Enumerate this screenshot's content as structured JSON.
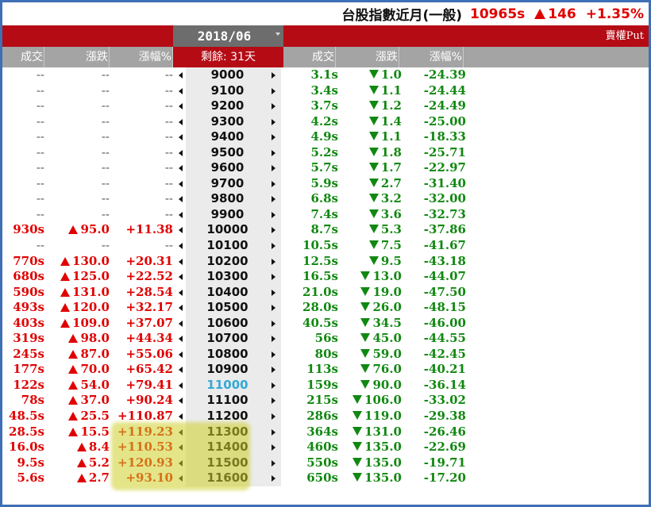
{
  "header": {
    "instrument": "台股指數近月(一般)",
    "price": "10965s",
    "change": "146",
    "change_pct": "+1.35%"
  },
  "month_selector": {
    "value": "2018/06"
  },
  "put_label": "賣權Put",
  "remaining": "剩餘: 31天",
  "columns": {
    "call": [
      "成交",
      "漲跌",
      "漲幅%"
    ],
    "put": [
      "成交",
      "漲跌",
      "漲幅%"
    ]
  },
  "colors": {
    "up": "#e00000",
    "down": "#118811",
    "header_red": "#b50b14",
    "atm_strike": "#33a8d6",
    "highlight": "#cdcd28"
  },
  "rows": [
    {
      "c_vol": "--",
      "c_dir": "",
      "c_chg": "--",
      "c_pct": "--",
      "strike": "9000",
      "p_vol": "3.1s",
      "p_dir": "down",
      "p_chg": "1.0",
      "p_pct": "-24.39"
    },
    {
      "c_vol": "--",
      "c_dir": "",
      "c_chg": "--",
      "c_pct": "--",
      "strike": "9100",
      "p_vol": "3.4s",
      "p_dir": "down",
      "p_chg": "1.1",
      "p_pct": "-24.44"
    },
    {
      "c_vol": "--",
      "c_dir": "",
      "c_chg": "--",
      "c_pct": "--",
      "strike": "9200",
      "p_vol": "3.7s",
      "p_dir": "down",
      "p_chg": "1.2",
      "p_pct": "-24.49"
    },
    {
      "c_vol": "--",
      "c_dir": "",
      "c_chg": "--",
      "c_pct": "--",
      "strike": "9300",
      "p_vol": "4.2s",
      "p_dir": "down",
      "p_chg": "1.4",
      "p_pct": "-25.00"
    },
    {
      "c_vol": "--",
      "c_dir": "",
      "c_chg": "--",
      "c_pct": "--",
      "strike": "9400",
      "p_vol": "4.9s",
      "p_dir": "down",
      "p_chg": "1.1",
      "p_pct": "-18.33"
    },
    {
      "c_vol": "--",
      "c_dir": "",
      "c_chg": "--",
      "c_pct": "--",
      "strike": "9500",
      "p_vol": "5.2s",
      "p_dir": "down",
      "p_chg": "1.8",
      "p_pct": "-25.71"
    },
    {
      "c_vol": "--",
      "c_dir": "",
      "c_chg": "--",
      "c_pct": "--",
      "strike": "9600",
      "p_vol": "5.7s",
      "p_dir": "down",
      "p_chg": "1.7",
      "p_pct": "-22.97"
    },
    {
      "c_vol": "--",
      "c_dir": "",
      "c_chg": "--",
      "c_pct": "--",
      "strike": "9700",
      "p_vol": "5.9s",
      "p_dir": "down",
      "p_chg": "2.7",
      "p_pct": "-31.40"
    },
    {
      "c_vol": "--",
      "c_dir": "",
      "c_chg": "--",
      "c_pct": "--",
      "strike": "9800",
      "p_vol": "6.8s",
      "p_dir": "down",
      "p_chg": "3.2",
      "p_pct": "-32.00"
    },
    {
      "c_vol": "--",
      "c_dir": "",
      "c_chg": "--",
      "c_pct": "--",
      "strike": "9900",
      "p_vol": "7.4s",
      "p_dir": "down",
      "p_chg": "3.6",
      "p_pct": "-32.73"
    },
    {
      "c_vol": "930s",
      "c_dir": "up",
      "c_chg": "95.0",
      "c_pct": "+11.38",
      "strike": "10000",
      "p_vol": "8.7s",
      "p_dir": "down",
      "p_chg": "5.3",
      "p_pct": "-37.86"
    },
    {
      "c_vol": "--",
      "c_dir": "",
      "c_chg": "--",
      "c_pct": "--",
      "strike": "10100",
      "p_vol": "10.5s",
      "p_dir": "down",
      "p_chg": "7.5",
      "p_pct": "-41.67"
    },
    {
      "c_vol": "770s",
      "c_dir": "up",
      "c_chg": "130.0",
      "c_pct": "+20.31",
      "strike": "10200",
      "p_vol": "12.5s",
      "p_dir": "down",
      "p_chg": "9.5",
      "p_pct": "-43.18"
    },
    {
      "c_vol": "680s",
      "c_dir": "up",
      "c_chg": "125.0",
      "c_pct": "+22.52",
      "strike": "10300",
      "p_vol": "16.5s",
      "p_dir": "down",
      "p_chg": "13.0",
      "p_pct": "-44.07"
    },
    {
      "c_vol": "590s",
      "c_dir": "up",
      "c_chg": "131.0",
      "c_pct": "+28.54",
      "strike": "10400",
      "p_vol": "21.0s",
      "p_dir": "down",
      "p_chg": "19.0",
      "p_pct": "-47.50"
    },
    {
      "c_vol": "493s",
      "c_dir": "up",
      "c_chg": "120.0",
      "c_pct": "+32.17",
      "strike": "10500",
      "p_vol": "28.0s",
      "p_dir": "down",
      "p_chg": "26.0",
      "p_pct": "-48.15"
    },
    {
      "c_vol": "403s",
      "c_dir": "up",
      "c_chg": "109.0",
      "c_pct": "+37.07",
      "strike": "10600",
      "p_vol": "40.5s",
      "p_dir": "down",
      "p_chg": "34.5",
      "p_pct": "-46.00"
    },
    {
      "c_vol": "319s",
      "c_dir": "up",
      "c_chg": "98.0",
      "c_pct": "+44.34",
      "strike": "10700",
      "p_vol": "56s",
      "p_dir": "down",
      "p_chg": "45.0",
      "p_pct": "-44.55"
    },
    {
      "c_vol": "245s",
      "c_dir": "up",
      "c_chg": "87.0",
      "c_pct": "+55.06",
      "strike": "10800",
      "p_vol": "80s",
      "p_dir": "down",
      "p_chg": "59.0",
      "p_pct": "-42.45"
    },
    {
      "c_vol": "177s",
      "c_dir": "up",
      "c_chg": "70.0",
      "c_pct": "+65.42",
      "strike": "10900",
      "p_vol": "113s",
      "p_dir": "down",
      "p_chg": "76.0",
      "p_pct": "-40.21"
    },
    {
      "c_vol": "122s",
      "c_dir": "up",
      "c_chg": "54.0",
      "c_pct": "+79.41",
      "strike": "11000",
      "atm": true,
      "p_vol": "159s",
      "p_dir": "down",
      "p_chg": "90.0",
      "p_pct": "-36.14"
    },
    {
      "c_vol": "78s",
      "c_dir": "up",
      "c_chg": "37.0",
      "c_pct": "+90.24",
      "strike": "11100",
      "p_vol": "215s",
      "p_dir": "down",
      "p_chg": "106.0",
      "p_pct": "-33.02"
    },
    {
      "c_vol": "48.5s",
      "c_dir": "up",
      "c_chg": "25.5",
      "c_pct": "+110.87",
      "strike": "11200",
      "p_vol": "286s",
      "p_dir": "down",
      "p_chg": "119.0",
      "p_pct": "-29.38"
    },
    {
      "c_vol": "28.5s",
      "c_dir": "up",
      "c_chg": "15.5",
      "c_pct": "+119.23",
      "strike": "11300",
      "p_vol": "364s",
      "p_dir": "down",
      "p_chg": "131.0",
      "p_pct": "-26.46"
    },
    {
      "c_vol": "16.0s",
      "c_dir": "up",
      "c_chg": "8.4",
      "c_pct": "+110.53",
      "strike": "11400",
      "p_vol": "460s",
      "p_dir": "down",
      "p_chg": "135.0",
      "p_pct": "-22.69"
    },
    {
      "c_vol": "9.5s",
      "c_dir": "up",
      "c_chg": "5.2",
      "c_pct": "+120.93",
      "strike": "11500",
      "p_vol": "550s",
      "p_dir": "down",
      "p_chg": "135.0",
      "p_pct": "-19.71"
    },
    {
      "c_vol": "5.6s",
      "c_dir": "up",
      "c_chg": "2.7",
      "c_pct": "+93.10",
      "strike": "11600",
      "p_vol": "650s",
      "p_dir": "down",
      "p_chg": "135.0",
      "p_pct": "-17.20"
    }
  ]
}
